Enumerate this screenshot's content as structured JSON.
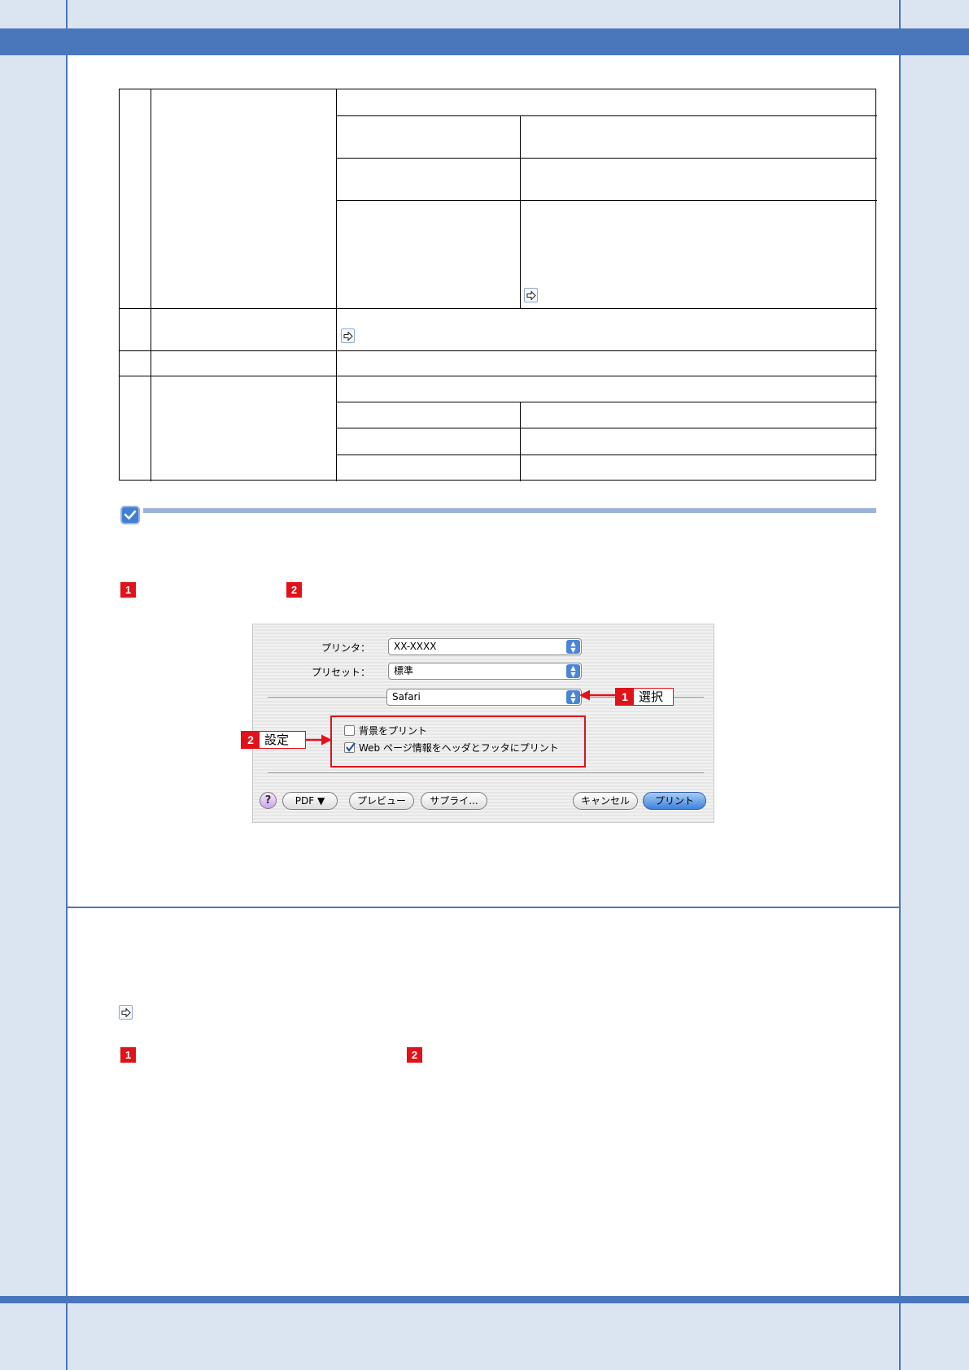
{
  "dialog": {
    "printer_label": "プリンタ：",
    "printer_value": "XX-XXXX",
    "preset_label": "プリセット：",
    "preset_value": "標準",
    "panel_value": "Safari",
    "option_print_background": "背景をプリント",
    "option_print_header_footer": "Web ページ情報をヘッダとフッタにプリント",
    "print_background_checked": false,
    "print_header_footer_checked": true,
    "help_label": "?",
    "pdf_button": "PDF ▼",
    "preview_button": "プレビュー",
    "supplies_button": "サプライ...",
    "cancel_button": "キャンセル",
    "print_button": "プリント"
  },
  "callouts": {
    "select": {
      "num": "1",
      "text": "選択"
    },
    "set": {
      "num": "2",
      "text": "設定"
    }
  },
  "steps": {
    "a1": "1",
    "a2": "2",
    "b1": "1",
    "b2": "2"
  },
  "icons": {
    "link": "link-arrow-icon",
    "note": "check-icon"
  },
  "colors": {
    "band": "#4a76bb",
    "page_bg": "#dbe5f1",
    "note_rule": "#9cb3d9",
    "accent_red": "#e0121a"
  }
}
